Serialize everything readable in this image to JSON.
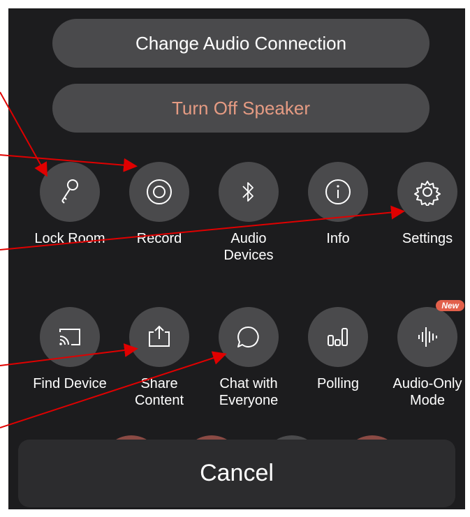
{
  "top_buttons": {
    "change_audio": "Change Audio Connection",
    "turn_off_speaker": "Turn Off Speaker"
  },
  "row1": [
    {
      "label": "Lock Room",
      "icon": "key-icon"
    },
    {
      "label": "Record",
      "icon": "record-icon"
    },
    {
      "label": "Audio\nDevices",
      "icon": "bluetooth-icon"
    },
    {
      "label": "Info",
      "icon": "info-icon"
    },
    {
      "label": "Settings",
      "icon": "gear-icon"
    }
  ],
  "row2": [
    {
      "label": "Find Device",
      "icon": "cast-icon"
    },
    {
      "label": "Share\nContent",
      "icon": "share-upload-icon"
    },
    {
      "label": "Chat with\nEveryone",
      "icon": "chat-bubble-icon"
    },
    {
      "label": "Polling",
      "icon": "polling-bars-icon"
    },
    {
      "label": "Audio-Only\nMode",
      "icon": "waveform-icon",
      "badge": "New"
    }
  ],
  "cancel": "Cancel",
  "colors": {
    "background": "#1c1c1e",
    "button": "#4a4a4c",
    "speaker_text": "#e59b83",
    "badge": "#e2604b",
    "annotation_arrow": "#e00000"
  }
}
